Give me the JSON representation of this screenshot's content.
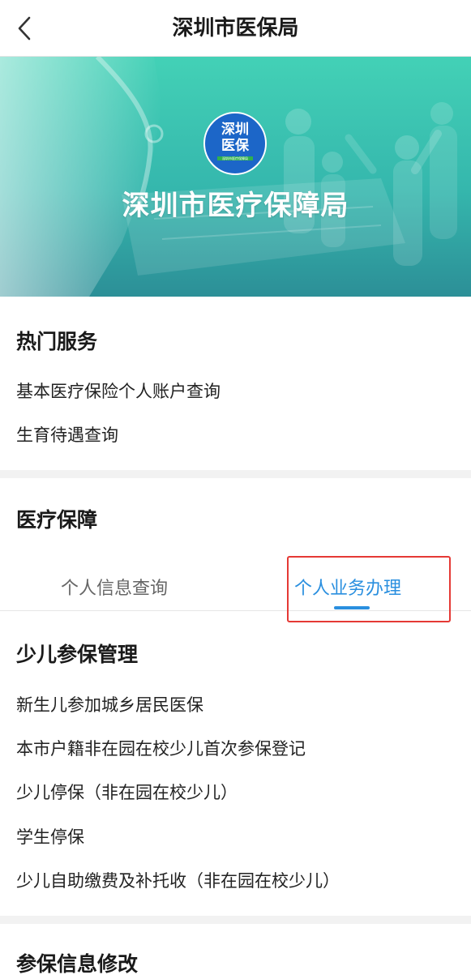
{
  "header": {
    "title": "深圳市医保局"
  },
  "banner": {
    "logo_line1": "深圳",
    "logo_line2": "医保",
    "logo_sub": "深圳市医疗保障局",
    "title": "深圳市医疗保障局"
  },
  "hot_services": {
    "title": "热门服务",
    "items": [
      "基本医疗保险个人账户查询",
      "生育待遇查询"
    ]
  },
  "medical": {
    "title": "医疗保障",
    "tabs": [
      {
        "label": "个人信息查询",
        "active": false
      },
      {
        "label": "个人业务办理",
        "active": true
      }
    ],
    "group_title": "少儿参保管理",
    "items": [
      "新生儿参加城乡居民医保",
      "本市户籍非在园在校少儿首次参保登记",
      "少儿停保（非在园在校少儿）",
      "学生停保",
      "少儿自助缴费及补托收（非在园在校少儿）"
    ]
  },
  "insurance_edit": {
    "title": "参保信息修改"
  },
  "colors": {
    "accent": "#2a8fdf",
    "highlight_box": "#e53935",
    "banner_teal": "#3ecbb0",
    "logo_blue": "#1c66c8"
  }
}
